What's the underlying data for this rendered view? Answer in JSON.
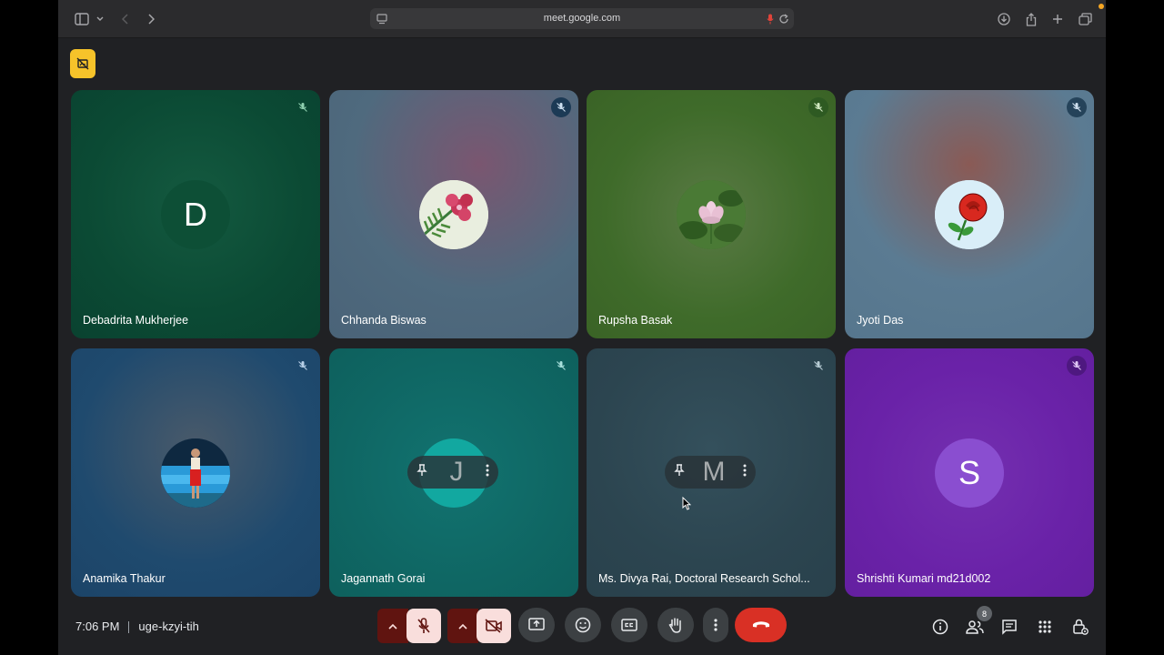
{
  "browser": {
    "url": "meet.google.com"
  },
  "tiles": [
    {
      "name": "Debadrita Mukherjee",
      "avatar_letter": "D",
      "bg": "#0b4a34"
    },
    {
      "name": "Chhanda Biswas",
      "avatar_letter": "",
      "bg": "#4f6a7e"
    },
    {
      "name": "Rupsha Basak",
      "avatar_letter": "",
      "bg": "#3f6b2a"
    },
    {
      "name": "Jyoti Das",
      "avatar_letter": "",
      "bg": "#5b7b92"
    },
    {
      "name": "Anamika Thakur",
      "avatar_letter": "",
      "bg": "#1f4a6e"
    },
    {
      "name": "Jagannath Gorai",
      "avatar_letter": "J",
      "bg": "#0f6764"
    },
    {
      "name": "Ms. Divya Rai, Doctoral Research Schol...",
      "avatar_letter": "M",
      "bg": "#2c4550"
    },
    {
      "name": "Shrishti Kumari md21d002",
      "avatar_letter": "S",
      "bg": "#6a22a8"
    }
  ],
  "meeting": {
    "time": "7:06 PM",
    "code": "uge-kzyi-tih",
    "participant_count": "8"
  },
  "colors": {
    "end_call": "#d93025",
    "accent_dark_red": "#601410",
    "accent_light_red": "#f9dedc",
    "ai_badge": "#f6c32a"
  }
}
